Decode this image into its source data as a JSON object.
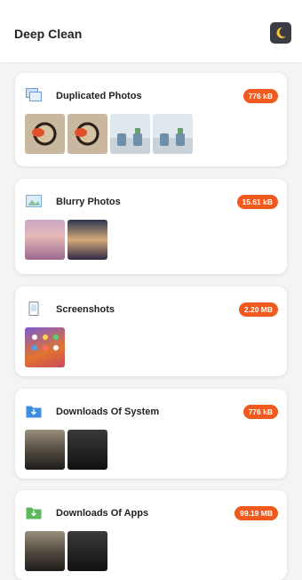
{
  "header": {
    "title": "Deep Clean",
    "theme_icon": "moon-icon"
  },
  "cards": [
    {
      "title": "Duplicated Photos",
      "size": "776 kB",
      "icon": "duplicate-photos-icon"
    },
    {
      "title": "Blurry Photos",
      "size": "15.61 kB",
      "icon": "blurry-photo-icon"
    },
    {
      "title": "Screenshots",
      "size": "2.20 MB",
      "icon": "screenshot-icon"
    },
    {
      "title": "Downloads Of System",
      "size": "776 kB",
      "icon": "system-download-icon"
    },
    {
      "title": "Downloads Of Apps",
      "size": "99.19 MB",
      "icon": "app-download-icon"
    }
  ],
  "colors": {
    "accent": "#f05a1e",
    "dark_button": "#3a3e44"
  }
}
